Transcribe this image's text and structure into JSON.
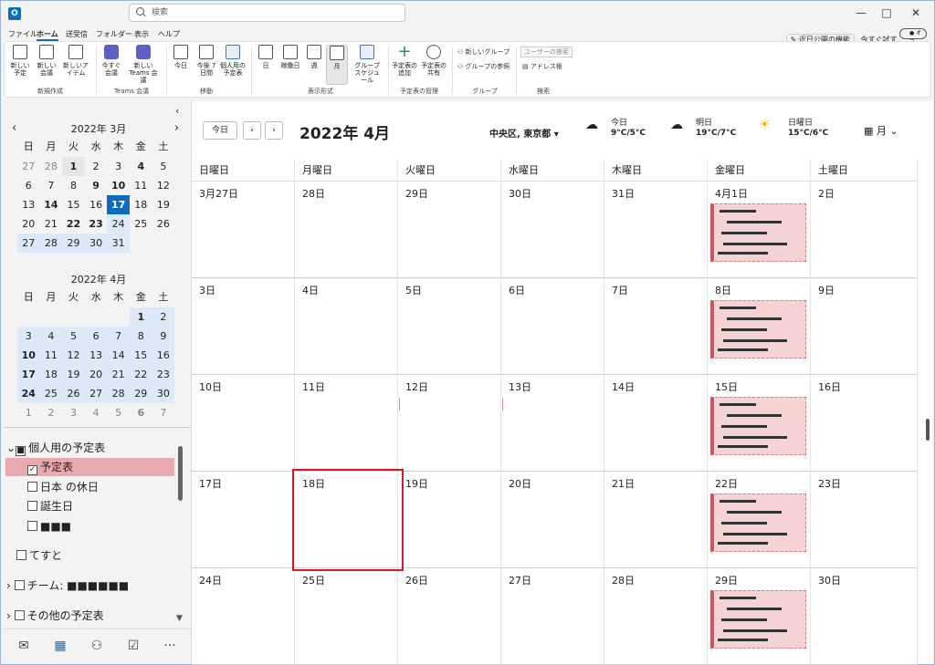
{
  "app": {
    "search_placeholder": "検索",
    "logo": "O"
  },
  "menus": [
    "ファイル",
    "ホーム",
    "送受信",
    "フォルダー",
    "表示",
    "ヘルプ"
  ],
  "right_tools": {
    "coming_soon": "近日公開の機能",
    "try_now": "今すぐ試す",
    "toggle": "オフ"
  },
  "ribbon": {
    "new_group": {
      "label": "新規作成",
      "buttons": [
        "新しい予定",
        "新しい会議",
        "新しいアイテム"
      ]
    },
    "teams_group": {
      "label": "Teams 会議",
      "buttons": [
        "今すぐ会議",
        "新しい Teams 会議"
      ]
    },
    "go_group": {
      "label": "移動",
      "buttons": [
        "今日",
        "今後 7 日間",
        "個人用の予定表"
      ]
    },
    "view_group": {
      "label": "表示形式",
      "buttons": [
        "日",
        "稼働日",
        "週",
        "月",
        "グループ スケジュール"
      ]
    },
    "manage_group": {
      "label": "予定表の管理",
      "buttons": [
        "予定表の追加",
        "予定表の共有"
      ]
    },
    "groups_group": {
      "label": "グループ",
      "buttons": [
        "新しいグループ",
        "グループの参照"
      ]
    },
    "find_group": {
      "label": "検索",
      "search_people": "ユーザーの検索",
      "address_book": "アドレス帳"
    }
  },
  "mini_cal": {
    "weekdays": [
      "日",
      "月",
      "火",
      "水",
      "木",
      "金",
      "土"
    ],
    "march": {
      "title": "2022年 3月",
      "days": [
        "27",
        "28",
        "1",
        "2",
        "3",
        "4",
        "5",
        "6",
        "7",
        "8",
        "9",
        "10",
        "11",
        "12",
        "13",
        "14",
        "15",
        "16",
        "17",
        "18",
        "19",
        "20",
        "21",
        "22",
        "23",
        "24",
        "25",
        "26",
        "27",
        "28",
        "29",
        "30",
        "31"
      ]
    },
    "april": {
      "title": "2022年 4月",
      "days": [
        "",
        "",
        "",
        "",
        "",
        "1",
        "2",
        "3",
        "4",
        "5",
        "6",
        "7",
        "8",
        "9",
        "10",
        "11",
        "12",
        "13",
        "14",
        "15",
        "16",
        "17",
        "18",
        "19",
        "20",
        "21",
        "22",
        "23",
        "24",
        "25",
        "26",
        "27",
        "28",
        "29",
        "30",
        "1",
        "2",
        "3",
        "4",
        "5",
        "6",
        "7"
      ]
    }
  },
  "folders": {
    "personal": "個人用の予定表",
    "items": [
      "予定表",
      "日本 の休日",
      "誕生日",
      "■■■"
    ],
    "test": "てすと",
    "team": "チーム: ■■■■■■",
    "other": "その他の予定表"
  },
  "main": {
    "today_btn": "今日",
    "title": "2022年 4月",
    "location": "中央区, 東京都",
    "weather": [
      {
        "day": "今日",
        "temp": "9°C/5°C"
      },
      {
        "day": "明日",
        "temp": "19°C/7°C"
      },
      {
        "day": "日曜日",
        "temp": "15°C/6°C"
      }
    ],
    "view_label": "月",
    "weekdays": [
      "日曜日",
      "月曜日",
      "火曜日",
      "水曜日",
      "木曜日",
      "金曜日",
      "土曜日"
    ],
    "weeks": [
      [
        "3月27日",
        "28日",
        "29日",
        "30日",
        "31日",
        "4月1日",
        "2日"
      ],
      [
        "3日",
        "4日",
        "5日",
        "6日",
        "7日",
        "8日",
        "9日"
      ],
      [
        "10日",
        "11日",
        "12日",
        "13日",
        "14日",
        "15日",
        "16日"
      ],
      [
        "17日",
        "18日",
        "19日",
        "20日",
        "21日",
        "22日",
        "23日"
      ],
      [
        "24日",
        "25日",
        "26日",
        "27日",
        "28日",
        "29日",
        "30日"
      ]
    ]
  },
  "colors": {
    "accent": "#0f6cbd",
    "selection": "#d51b24",
    "event_bg": "#f5d3d4"
  }
}
